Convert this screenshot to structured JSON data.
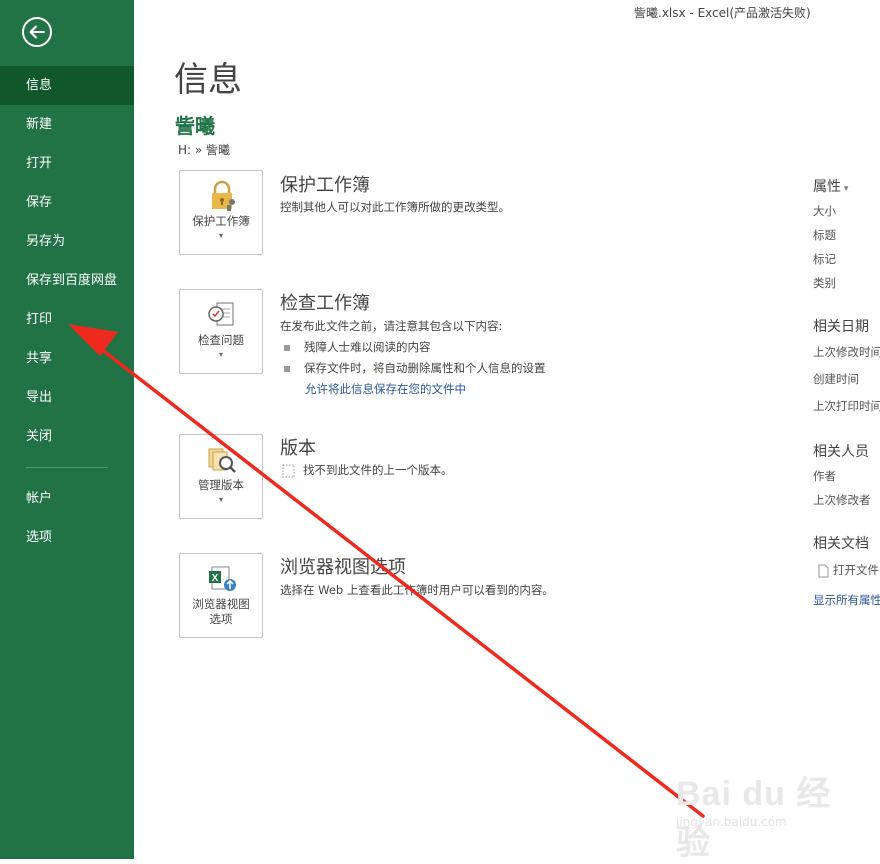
{
  "window": {
    "title": "訾曦.xlsx - Excel(产品激活失败)"
  },
  "sidebar": {
    "items": [
      {
        "label": "信息",
        "active": true
      },
      {
        "label": "新建"
      },
      {
        "label": "打开"
      },
      {
        "label": "保存"
      },
      {
        "label": "另存为"
      },
      {
        "label": "保存到百度网盘"
      },
      {
        "label": "打印"
      },
      {
        "label": "共享"
      },
      {
        "label": "导出"
      },
      {
        "label": "关闭"
      }
    ],
    "bottom_items": [
      {
        "label": "帐户"
      },
      {
        "label": "选项"
      }
    ]
  },
  "main": {
    "title": "信息",
    "file_name": "訾曦",
    "file_path": "H: » 訾曦",
    "sections": [
      {
        "button_label": "保护工作簿",
        "title": "保护工作簿",
        "desc": "控制其他人可以对此工作簿所做的更改类型。"
      },
      {
        "button_label": "检查问题",
        "title": "检查工作簿",
        "desc": "在发布此文件之前，请注意其包含以下内容:",
        "bullets": [
          "残障人士难以阅读的内容",
          "保存文件时，将自动删除属性和个人信息的设置"
        ],
        "link": "允许将此信息保存在您的文件中"
      },
      {
        "button_label": "管理版本",
        "title": "版本",
        "desc": "找不到此文件的上一个版本。"
      },
      {
        "button_label": "浏览器视图选项",
        "button_label_line1": "浏览器视图",
        "button_label_line2": "选项",
        "title": "浏览器视图选项",
        "desc": "选择在 Web 上查看此工作簿时用户可以看到的内容。"
      }
    ]
  },
  "properties": {
    "heading": "属性",
    "items": [
      "大小",
      "标题",
      "标记",
      "类别"
    ],
    "dates_heading": "相关日期",
    "dates": [
      "上次修改时间",
      "创建时间",
      "上次打印时间"
    ],
    "people_heading": "相关人员",
    "people": [
      "作者",
      "上次修改者"
    ],
    "docs_heading": "相关文档",
    "docs_item": "打开文件",
    "show_all": "显示所有属性"
  },
  "watermark": {
    "main": "Bai du 经验",
    "url": "jingyan.baidu.com"
  },
  "colors": {
    "sidebar": "#217346",
    "sidebar_active": "#10572c",
    "accent": "#217346",
    "link": "#2b579a",
    "annotation_arrow": "#ee2a1f"
  }
}
